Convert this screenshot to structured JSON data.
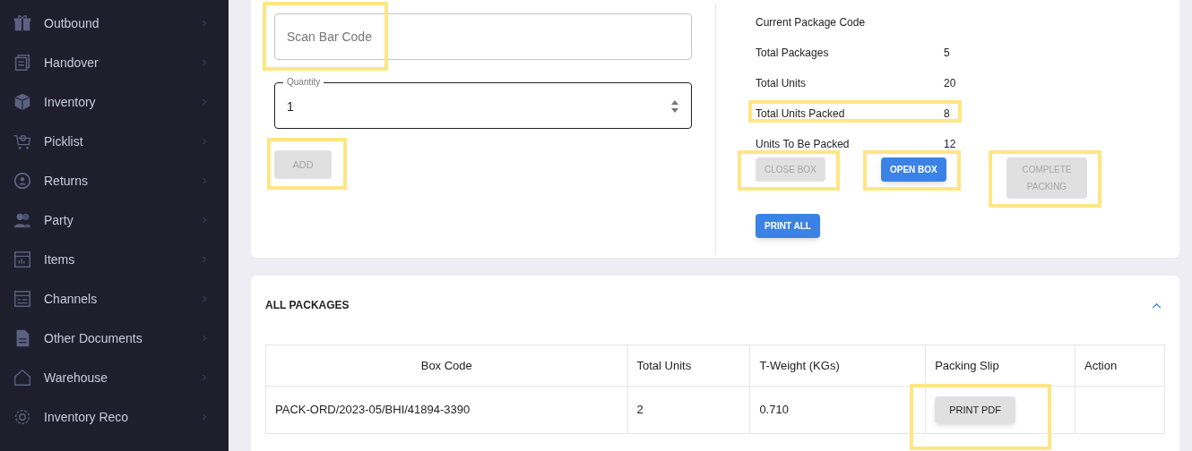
{
  "sidebar": {
    "items": [
      {
        "label": "Outbound"
      },
      {
        "label": "Handover"
      },
      {
        "label": "Inventory"
      },
      {
        "label": "Picklist"
      },
      {
        "label": "Returns"
      },
      {
        "label": "Party"
      },
      {
        "label": "Items"
      },
      {
        "label": "Channels"
      },
      {
        "label": "Other Documents"
      },
      {
        "label": "Warehouse"
      },
      {
        "label": "Inventory Reco"
      }
    ]
  },
  "scan_form": {
    "barcode_field": {
      "placeholder": "Scan Bar Code",
      "highlighted": true
    },
    "quantity_field": {
      "label": "Quantity",
      "value": "1"
    },
    "add_button": {
      "label": "ADD",
      "disabled": true,
      "highlighted": true
    }
  },
  "summary": {
    "rows": [
      {
        "label": "Current Package Code",
        "highlighted": false
      },
      {
        "label": "Total Packages",
        "value": "5",
        "highlighted": false
      },
      {
        "label": "Total Units",
        "value": "20",
        "highlighted": false
      },
      {
        "label": "Total Units Packed",
        "value": "8",
        "highlighted": true
      },
      {
        "label": "Units To Be Packed",
        "value": "12",
        "highlighted": false
      }
    ],
    "buttons": [
      {
        "label": "CLOSE BOX",
        "disabled": true,
        "highlighted": true
      },
      {
        "label": "OPEN BOX",
        "disabled": false,
        "highlighted": true
      },
      {
        "label": "COMPLETE PACKING",
        "disabled": true,
        "highlighted": true
      },
      {
        "label": "PRINT ALL",
        "disabled": false,
        "highlighted": false
      }
    ]
  },
  "packages": {
    "title": "ALL PACKAGES",
    "expanded": true,
    "columns": [
      "Box Code",
      "Total Units",
      "T-Weight (KGs)",
      "Packing Slip",
      "Action"
    ],
    "rows": [
      {
        "box_code": "PACK-ORD/2023-05/BHI/41894-3390",
        "total_units": "2",
        "weight": "0.710",
        "packing_slip": {
          "label": "PRINT PDF",
          "highlighted": true
        }
      }
    ]
  }
}
